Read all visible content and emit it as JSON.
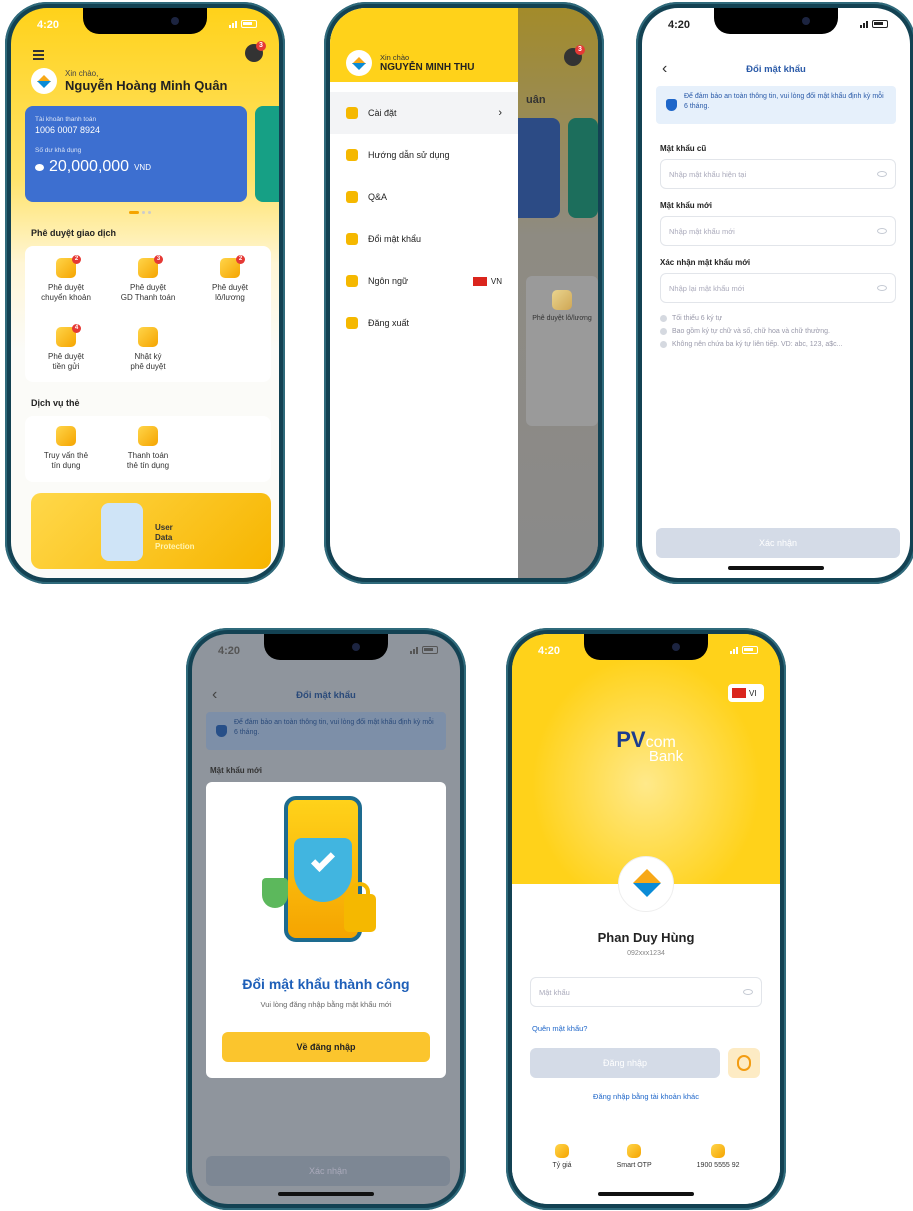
{
  "status": {
    "time": "4:20"
  },
  "home": {
    "greeting": "Xin chào,",
    "name": "Nguyễn Hoàng Minh Quân",
    "account_label": "Tài khoản thanh toán",
    "account_number": "1006 0007 8924",
    "balance_label": "Số dư khả dụng",
    "balance": "20,000,000",
    "currency": "VND",
    "approval_title": "Phê duyệt giao dịch",
    "approvals": [
      {
        "l1": "Phê duyệt",
        "l2": "chuyển khoản",
        "badge": "2"
      },
      {
        "l1": "Phê duyệt",
        "l2": "GD Thanh toán",
        "badge": "3"
      },
      {
        "l1": "Phê duyệt",
        "l2": "lô/lương",
        "badge": "2"
      },
      {
        "l1": "Phê duyệt",
        "l2": "tiền gửi",
        "badge": "4"
      },
      {
        "l1": "Nhật ký",
        "l2": "phê duyệt",
        "badge": ""
      }
    ],
    "card_title": "Dịch vụ thẻ",
    "card_services": [
      {
        "l1": "Truy vấn thẻ",
        "l2": "tín dụng"
      },
      {
        "l1": "Thanh toán",
        "l2": "thẻ tín dụng"
      }
    ],
    "banner": {
      "l1": "User",
      "l2": "Data",
      "l3": "Protection"
    }
  },
  "menu": {
    "greeting": "Xin chào",
    "name": "NGUYỄN MINH THU",
    "items": [
      "Cài đặt",
      "Hướng dẫn sử dụng",
      "Q&A",
      "Đổi mật khẩu",
      "Ngôn ngữ",
      "Đăng xuất"
    ],
    "lang": "VN",
    "peek_name": "uân",
    "peek_tile": "Phê duyệt lô/lương"
  },
  "change": {
    "title": "Đổi mật khẩu",
    "notice": "Để đảm bảo an toàn thông tin, vui lòng đổi mật khẩu định kỳ mỗi 6 tháng.",
    "old_label": "Mật khẩu cũ",
    "old_ph": "Nhập mật khẩu hiện tại",
    "new_label": "Mật khẩu mới",
    "new_ph": "Nhập mật khẩu mới",
    "confirm_label": "Xác nhận mật khẩu mới",
    "confirm_ph": "Nhập lại mật khẩu mới",
    "rules": [
      "Tối thiểu 6 ký tự",
      "Bao gồm ký tự chữ và số, chữ hoa và chữ thường.",
      "Không nên chứa ba ký tự liên tiếp. VD: abc, 123, a$c..."
    ],
    "submit": "Xác nhận"
  },
  "success": {
    "title": "Đổi mật khẩu thành công",
    "subtitle": "Vui lòng đăng nhập bằng mật khẩu mới",
    "button": "Về đăng nhập",
    "bg_label": "Mật khẩu mới"
  },
  "login": {
    "lang": "VI",
    "brand1": "PV",
    "brand2": "com",
    "brand3": "Bank",
    "user_name": "Phan Duy Hùng",
    "phone": "092xxx1234",
    "password_ph": "Mật khẩu",
    "forgot": "Quên mật khẩu?",
    "login_btn": "Đăng nhập",
    "other_account": "Đăng nhập bằng tài khoản khác",
    "footer": [
      "Tỷ giá",
      "Smart OTP",
      "1900 5555 92"
    ]
  }
}
